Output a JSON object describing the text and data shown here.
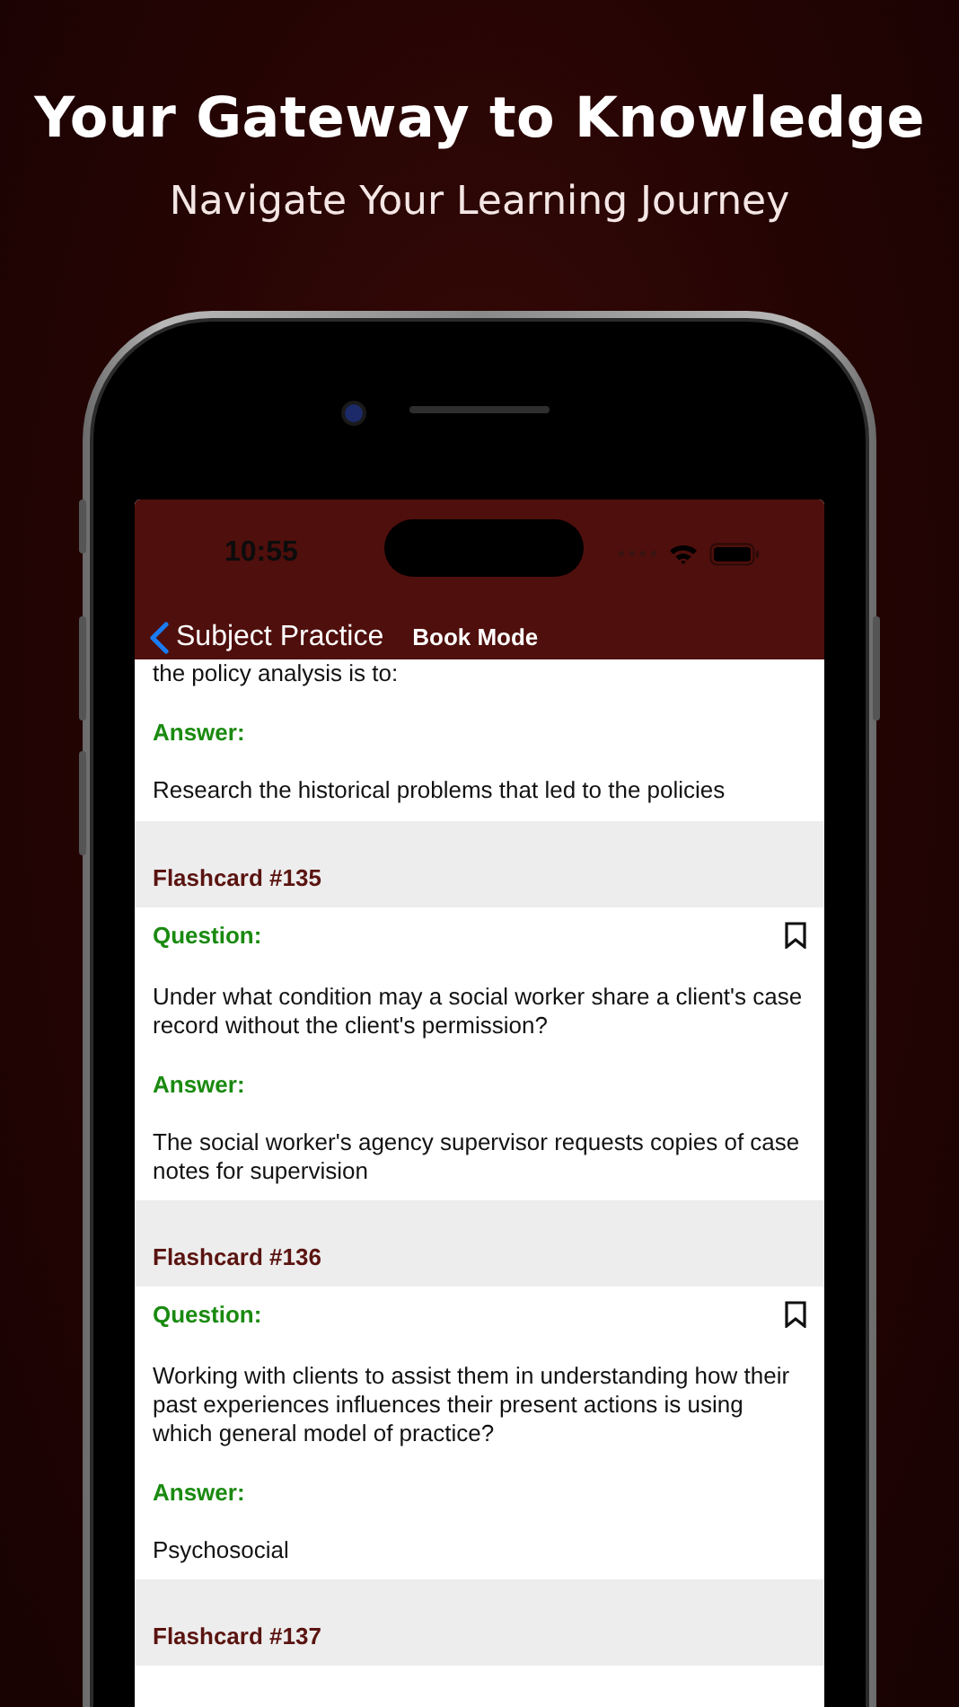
{
  "hero": {
    "title": "Your Gateway to Knowledge",
    "subtitle": "Navigate Your Learning Journey"
  },
  "status_bar": {
    "time": "10:55"
  },
  "nav": {
    "back_label": "Subject Practice",
    "title": "Book Mode"
  },
  "partial_card": {
    "question_tail": "the policy analysis is to:",
    "answer_label": "Answer:",
    "answer": "Research the historical problems that led to the policies"
  },
  "flashcards": [
    {
      "title": "Flashcard #135",
      "question_label": "Question:",
      "question": "Under what condition may a social worker share a client's case record without the client's permission?",
      "answer_label": "Answer:",
      "answer": "The social worker's agency supervisor requests copies of case notes for supervision",
      "bookmarked": false
    },
    {
      "title": "Flashcard #136",
      "question_label": "Question:",
      "question": "Working with clients to assist them in understanding how their past experiences influences their present actions is using which general model of practice?",
      "answer_label": "Answer:",
      "answer": "Psychosocial",
      "bookmarked": false
    },
    {
      "title": "Flashcard #137"
    }
  ]
}
